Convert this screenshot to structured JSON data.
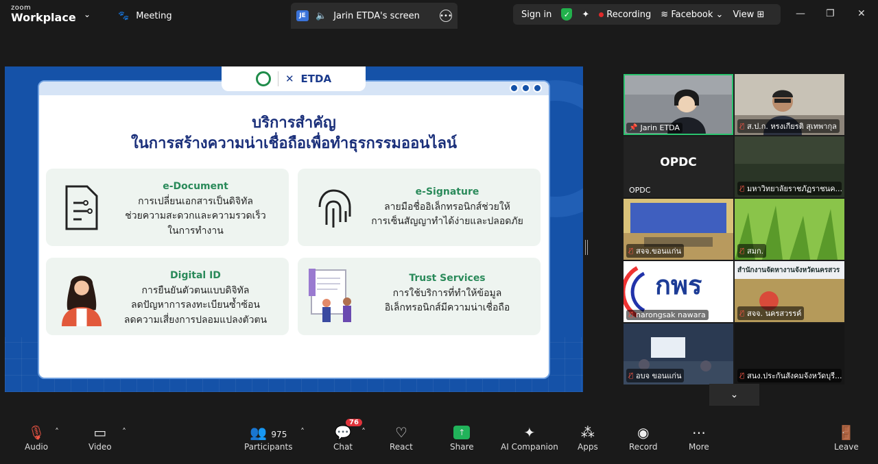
{
  "app": {
    "brand_line1": "zoom",
    "brand_line2": "Workplace"
  },
  "tabs": {
    "meeting": "Meeting",
    "screen_share": "Jarin ETDA's screen",
    "share_badge": "JE"
  },
  "header": {
    "sign_in": "Sign in",
    "recording": "Recording",
    "live": "Facebook",
    "view": "View"
  },
  "slide": {
    "partner_logo": "ETDA",
    "title_line1": "บริการสำคัญ",
    "title_line2": "ในการสร้างความน่าเชื่อถือเพื่อทำธุรกรรมออนไลน์",
    "cards": [
      {
        "title": "e-Document",
        "lines": [
          "การเปลี่ยนเอกสารเป็นดิจิทัล",
          "ช่วยความสะดวกและความรวดเร็ว",
          "ในการทำงาน"
        ]
      },
      {
        "title": "e-Signature",
        "lines": [
          "ลายมือชื่ออิเล็กทรอนิกส์ช่วยให้",
          "การเซ็นสัญญาทำได้ง่ายและปลอดภัย"
        ]
      },
      {
        "title": "Digital ID",
        "lines": [
          "การยืนยันตัวตนแบบดิจิทัล",
          "ลดปัญหาการลงทะเบียนซ้ำซ้อน",
          "ลดความเสี่ยงการปลอมแปลงตัวตน"
        ]
      },
      {
        "title": "Trust Services",
        "lines": [
          "การใช้บริการที่ทำให้ข้อมูล",
          "อิเล็กทรอนิกส์มีความน่าเชื่อถือ"
        ]
      }
    ]
  },
  "participants_grid": [
    {
      "name": "Jarin ETDA"
    },
    {
      "name": "ส.ป.ก. หรงเกียรติ สุเทพากุล"
    },
    {
      "name": "OPDC",
      "center": "OPDC"
    },
    {
      "name": "มหาวิทยาลัยราชภัฏราชนค..."
    },
    {
      "name": "สจจ.ขอนแก่น"
    },
    {
      "name": "สมก."
    },
    {
      "name": "narongsak nawara"
    },
    {
      "name": "สจจ. นครสวรรค์",
      "banner": "สำนักงานจัดหางานจังหวัดนครสวร"
    },
    {
      "name": "อบจ ขอนแก่น"
    },
    {
      "name": "สนง.ประกันสังคมจังหวัดบุรี..."
    }
  ],
  "toolbar": {
    "audio": "Audio",
    "video": "Video",
    "participants": "Participants",
    "participants_count": "975",
    "chat": "Chat",
    "chat_badge": "76",
    "react": "React",
    "share": "Share",
    "ai": "AI Companion",
    "apps": "Apps",
    "record": "Record",
    "more": "More",
    "leave": "Leave"
  },
  "colors": {
    "slide_bg": "#1552a8",
    "accent_green": "#2a8a5a",
    "title_navy": "#1a2f7a",
    "share_green": "#21b35a",
    "active_border": "#2bc46f"
  }
}
